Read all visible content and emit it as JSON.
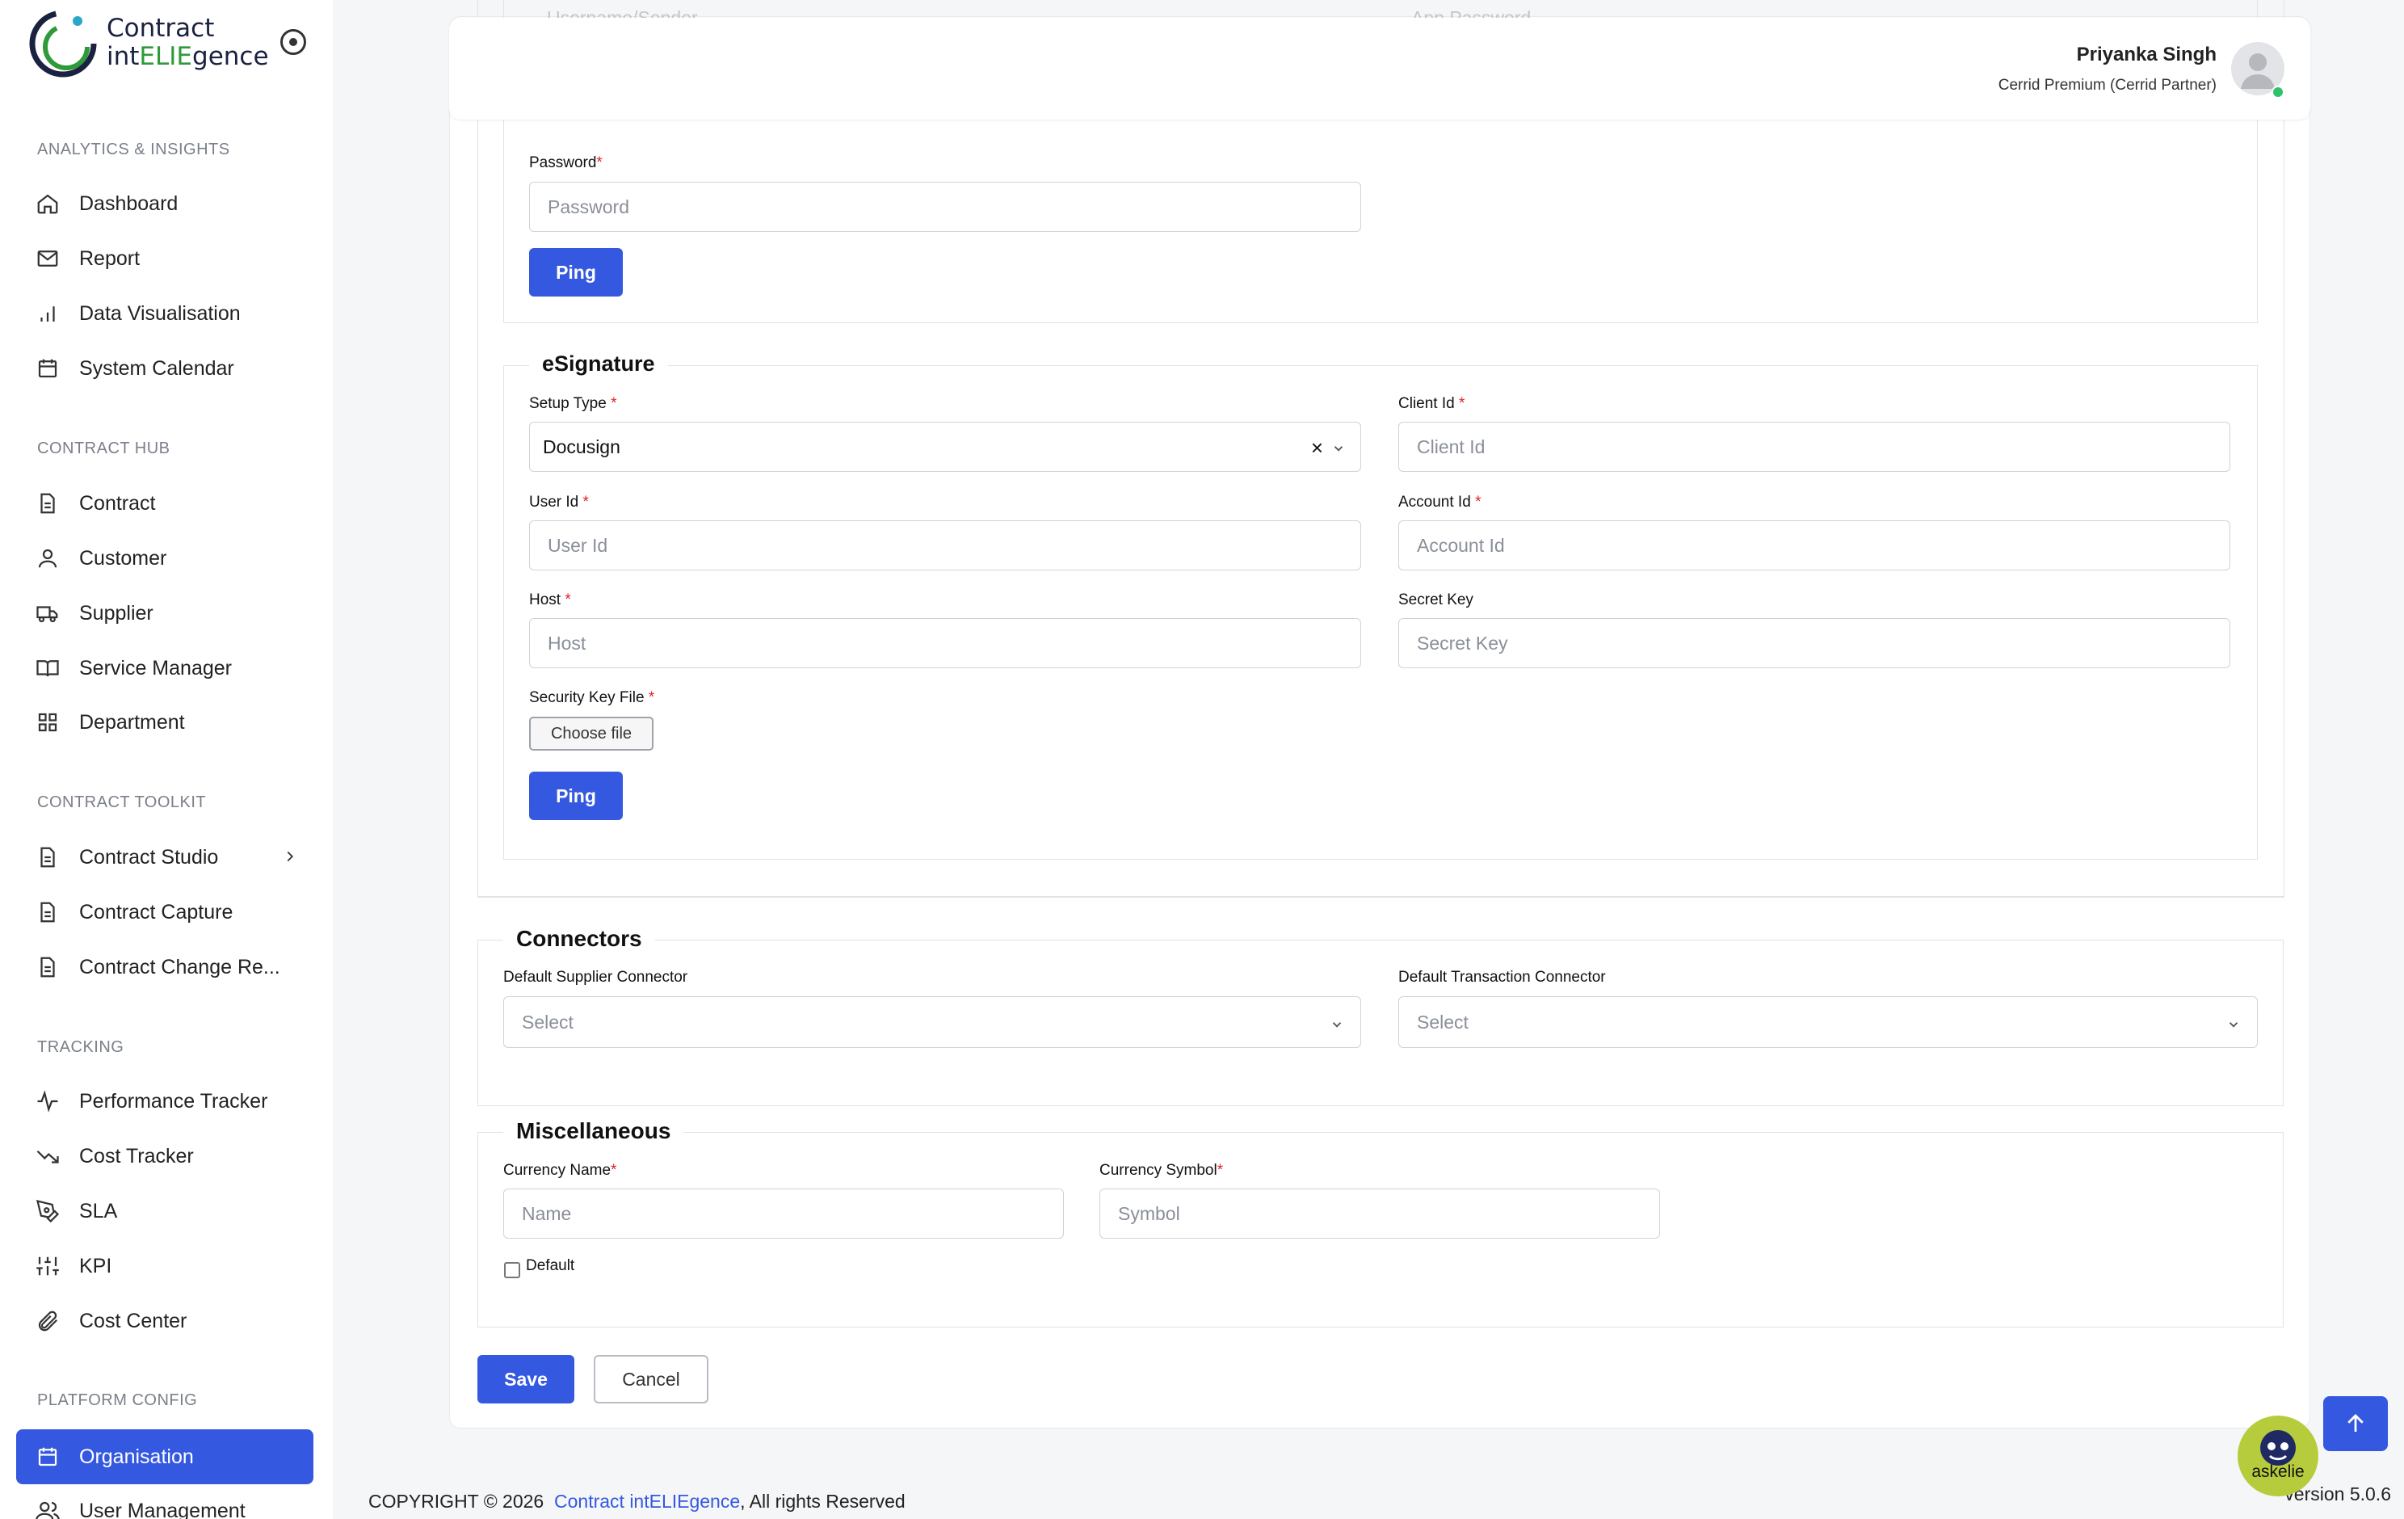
{
  "brand": {
    "line1": "Contract",
    "line2_pre": "int",
    "line2_accent": "ELIE",
    "line2_post": "gence"
  },
  "sidebar": {
    "sections": {
      "analytics": "ANALYTICS & INSIGHTS",
      "hub": "CONTRACT HUB",
      "toolkit": "CONTRACT TOOLKIT",
      "tracking": "TRACKING",
      "platform": "PLATFORM CONFIG"
    },
    "items": {
      "dashboard": "Dashboard",
      "report": "Report",
      "data_visualisation": "Data Visualisation",
      "system_calendar": "System Calendar",
      "contract": "Contract",
      "customer": "Customer",
      "supplier": "Supplier",
      "service_manager": "Service Manager",
      "department": "Department",
      "contract_studio": "Contract Studio",
      "contract_capture": "Contract Capture",
      "contract_change": "Contract Change Re...",
      "performance_tracker": "Performance Tracker",
      "cost_tracker": "Cost Tracker",
      "sla": "SLA",
      "kpi": "KPI",
      "cost_center": "Cost Center",
      "organisation": "Organisation",
      "user_management": "User Management"
    }
  },
  "header": {
    "user_name": "Priyanka Singh",
    "user_role": "Cerrid Premium (Cerrid Partner)"
  },
  "bleed": {
    "left_placeholder": "Username/Sender",
    "right_placeholder": "App Password"
  },
  "mail": {
    "password_label": "Password",
    "password_placeholder": "Password",
    "ping": "Ping"
  },
  "esignature": {
    "legend": "eSignature",
    "setup_type_label": "Setup Type",
    "setup_type_value": "Docusign",
    "client_id_label": "Client Id",
    "client_id_placeholder": "Client Id",
    "user_id_label": "User Id",
    "user_id_placeholder": "User Id",
    "account_id_label": "Account Id",
    "account_id_placeholder": "Account Id",
    "host_label": "Host",
    "host_placeholder": "Host",
    "secret_key_label": "Secret Key",
    "secret_key_placeholder": "Secret Key",
    "security_key_file_label": "Security Key File",
    "choose_file": "Choose file",
    "ping": "Ping"
  },
  "connectors": {
    "legend": "Connectors",
    "supplier_label": "Default Supplier Connector",
    "supplier_value": "Select",
    "transaction_label": "Default Transaction Connector",
    "transaction_value": "Select"
  },
  "misc": {
    "legend": "Miscellaneous",
    "currency_name_label": "Currency Name",
    "currency_name_placeholder": "Name",
    "currency_symbol_label": "Currency Symbol",
    "currency_symbol_placeholder": "Symbol",
    "default_label": "Default"
  },
  "actions": {
    "save": "Save",
    "cancel": "Cancel"
  },
  "footer": {
    "copyright_pre": "COPYRIGHT © 2026",
    "link": "Contract intELIEgence",
    "copyright_post": ", All rights Reserved",
    "version": "version 5.0.6"
  },
  "assistant": {
    "label": "askelie"
  },
  "required_mark": "*"
}
